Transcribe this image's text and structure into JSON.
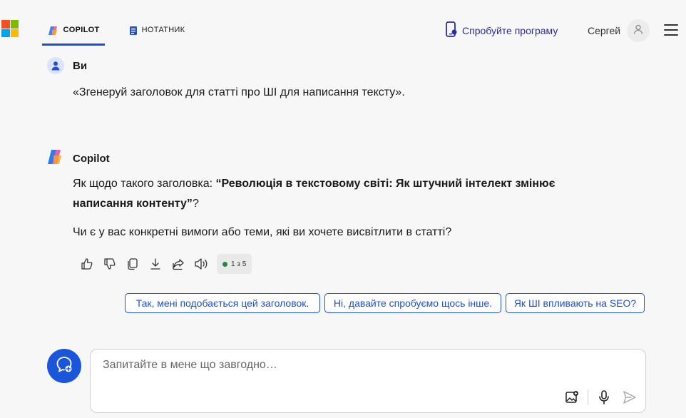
{
  "header": {
    "tabs": [
      {
        "label": "COPILOT",
        "active": true
      },
      {
        "label": "НОТАТНИК",
        "active": false
      }
    ],
    "try_app_label": "Спробуйте програму",
    "user_name": "Сергей"
  },
  "conversation": {
    "user": {
      "name": "Ви",
      "text": "«Згенеруй заголовок для статті про ШІ для написання тексту»."
    },
    "assistant": {
      "name": "Copilot",
      "intro": "Як щодо такого заголовка: ",
      "headline": "“Революція в текстовому світі: Як штучний інтелект змінює написання контенту”",
      "after_headline": "?",
      "question": "Чи є у вас конкретні вимоги або теми, які ви хочете висвітлити в статті?",
      "counter": "1 з 5"
    }
  },
  "suggestions": [
    "Так, мені подобається цей заголовок.",
    "Ні, давайте спробуємо щось інше.",
    "Як ШІ впливають на SEO?"
  ],
  "composer": {
    "placeholder": "Запитайте в мене що завгодно…"
  },
  "colors": {
    "accent": "#1d4fd8",
    "new_topic_bg": "#1a56db",
    "ms_red": "#f25022",
    "ms_green": "#7fba00",
    "ms_blue": "#00a4ef",
    "ms_yellow": "#ffb900"
  },
  "icons": [
    "microsoft-logo-icon",
    "copilot-icon",
    "notebook-icon",
    "phone-app-icon",
    "user-avatar-icon",
    "menu-icon",
    "thumbs-up-icon",
    "thumbs-down-icon",
    "copy-icon",
    "download-icon",
    "share-icon",
    "read-aloud-icon",
    "new-topic-icon",
    "image-upload-icon",
    "microphone-icon",
    "send-icon"
  ]
}
